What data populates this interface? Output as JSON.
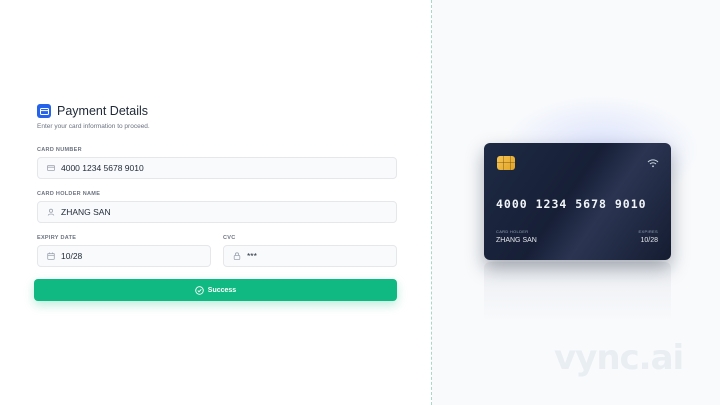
{
  "header": {
    "title": "Payment Details",
    "subtitle": "Enter your card information to proceed."
  },
  "form": {
    "card_number_label": "CARD NUMBER",
    "card_number_value": "4000 1234 5678 9010",
    "holder_label": "CARD HOLDER NAME",
    "holder_value": "ZHANG SAN",
    "expiry_label": "EXPIRY DATE",
    "expiry_value": "10/28",
    "cvc_label": "CVC",
    "cvc_value": "***"
  },
  "button": {
    "label": "Success",
    "icon": "check-circle-icon"
  },
  "card": {
    "number": "4000 1234 5678 9010",
    "holder_label": "CARD HOLDER",
    "holder_value": "ZHANG SAN",
    "expires_label": "EXPIRES",
    "expires_value": "10/28"
  },
  "watermark": "vync.ai",
  "colors": {
    "accent": "#10b981",
    "header_icon": "#2563eb",
    "card_bg": "#1e2a44",
    "chip": "#f6c453"
  }
}
